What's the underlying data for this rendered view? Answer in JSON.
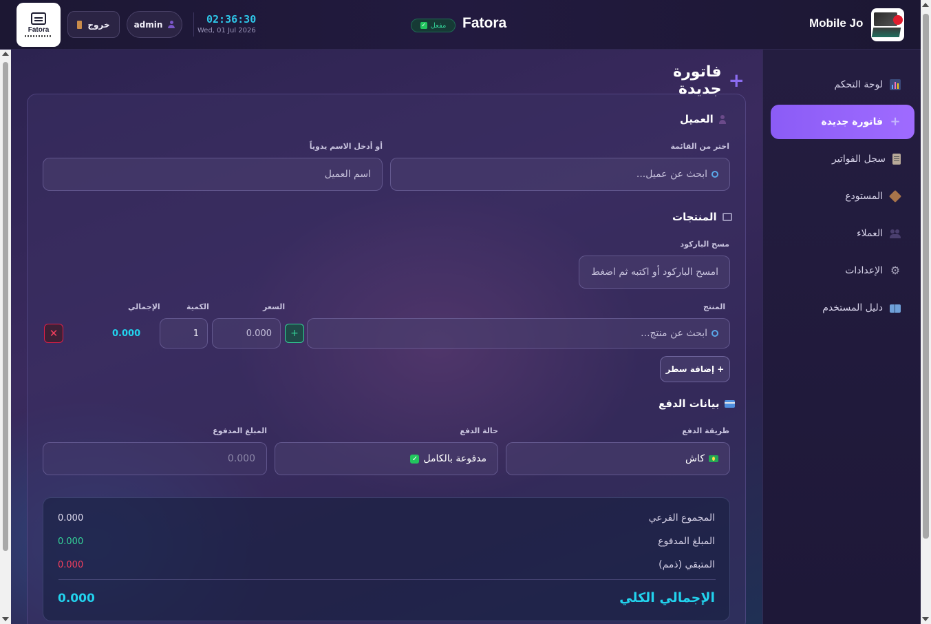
{
  "header": {
    "brand_logo_text": "Fatora",
    "logout_label": "خروج",
    "user_label": "admin",
    "clock_time": "02:36:30",
    "clock_date": "Wed, 01 Jul 2026",
    "app_title": "Fatora",
    "status_badge": "مفعل",
    "shop_name": "Mobile Jo"
  },
  "sidebar": {
    "items": [
      {
        "label": "لوحة التحكم",
        "icon": "chart-icon"
      },
      {
        "label": "فاتورة جديدة",
        "icon": "plus-icon",
        "active": true
      },
      {
        "label": "سجل الفواتير",
        "icon": "clipboard-icon"
      },
      {
        "label": "المستودع",
        "icon": "box-icon"
      },
      {
        "label": "العملاء",
        "icon": "users-icon"
      },
      {
        "label": "الإعدادات",
        "icon": "gear-icon"
      },
      {
        "label": "دليل المستخدم",
        "icon": "book-icon"
      }
    ]
  },
  "page": {
    "title": "فاتورة جديدة"
  },
  "customer": {
    "section_title": "العميل",
    "select_label": "اختر من القائمة",
    "search_placeholder": "ابحث عن عميل...",
    "manual_label": "أو أدخل الاسم يدوياً",
    "name_placeholder": "اسم العميل"
  },
  "products": {
    "section_title": "المنتجات",
    "barcode_label": "مسح الباركود",
    "barcode_placeholder": "امسح الباركود أو اكتبه ثم اضغط",
    "col_product": "المنتج",
    "col_price": "السعر",
    "col_qty": "الكمية",
    "col_total": "الإجمالي",
    "row": {
      "product_placeholder": "ابحث عن منتج...",
      "price": "0.000",
      "qty": "1",
      "total": "0.000"
    },
    "add_line_label": "+ إضافة سطر"
  },
  "payment": {
    "section_title": "بيانات الدفع",
    "method_label": "طريقة الدفع",
    "method_value": "كاش",
    "status_label": "حالة الدفع",
    "status_value": "مدفوعة بالكامل",
    "paid_label": "المبلغ المدفوع",
    "paid_placeholder": "0.000"
  },
  "summary": {
    "subtotal_label": "المجموع الفرعي",
    "subtotal_value": "0.000",
    "paid_label": "المبلغ المدفوع",
    "paid_value": "0.000",
    "remaining_label": "المتبقي (ذمم)",
    "remaining_value": "0.000",
    "total_label": "الإجمالي الكلي",
    "total_value": "0.000"
  },
  "colors": {
    "accent": "#8b5cf6",
    "cyan": "#22d3ee",
    "green": "#34d399",
    "red": "#f43f5e"
  }
}
